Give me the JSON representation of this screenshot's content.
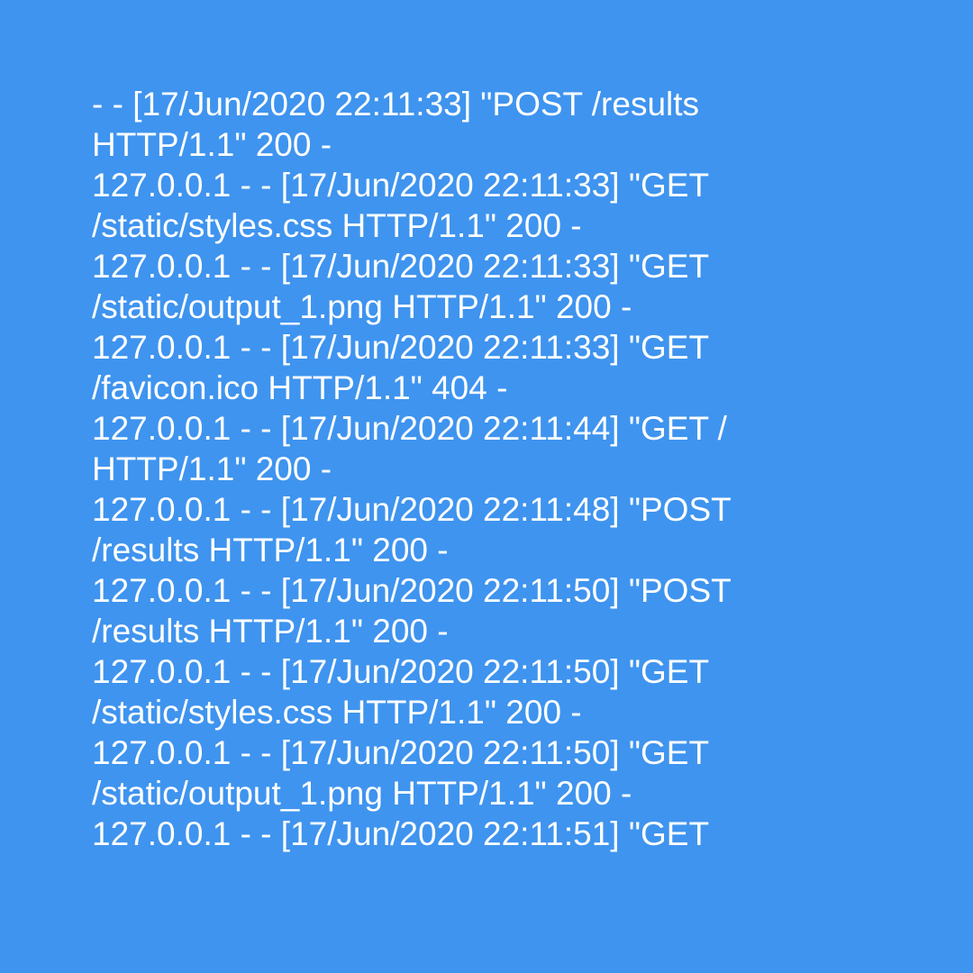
{
  "background_color": "#3f94ef",
  "text_color": "#ffffff",
  "log": {
    "lines": [
      "- - [17/Jun/2020 22:11:33] \"POST /results",
      "HTTP/1.1\" 200 -",
      "127.0.0.1 - - [17/Jun/2020 22:11:33] \"GET",
      "/static/styles.css HTTP/1.1\" 200 -",
      "127.0.0.1 - - [17/Jun/2020 22:11:33] \"GET",
      "/static/output_1.png HTTP/1.1\" 200 -",
      "127.0.0.1 - - [17/Jun/2020 22:11:33] \"GET",
      "/favicon.ico HTTP/1.1\" 404 -",
      "127.0.0.1 - - [17/Jun/2020 22:11:44] \"GET /",
      "HTTP/1.1\" 200 -",
      "127.0.0.1 - - [17/Jun/2020 22:11:48] \"POST",
      "/results HTTP/1.1\" 200 -",
      "127.0.0.1 - - [17/Jun/2020 22:11:50] \"POST",
      "/results HTTP/1.1\" 200 -",
      "127.0.0.1 - - [17/Jun/2020 22:11:50] \"GET",
      "/static/styles.css HTTP/1.1\" 200 -",
      "127.0.0.1 - - [17/Jun/2020 22:11:50] \"GET",
      "/static/output_1.png HTTP/1.1\" 200 -",
      "127.0.0.1 - - [17/Jun/2020 22:11:51] \"GET"
    ]
  }
}
